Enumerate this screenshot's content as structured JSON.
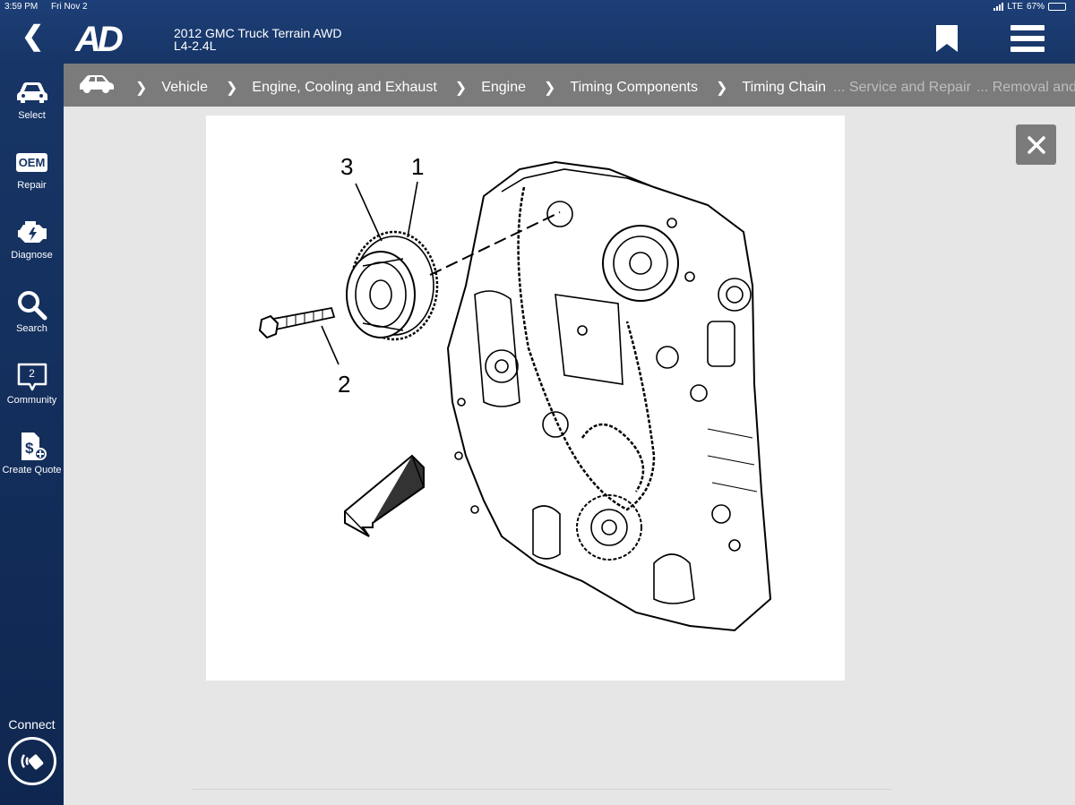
{
  "status_bar": {
    "time": "3:59 PM",
    "date": "Fri Nov 2",
    "network": "LTE",
    "battery": "67%"
  },
  "header": {
    "logo_text": "AD",
    "vehicle_name": "2012 GMC Truck Terrain AWD",
    "engine": "L4-2.4L",
    "icons": [
      "back-chevron-icon",
      "bookmark-icon",
      "hamburger-menu-icon"
    ]
  },
  "sidebar": {
    "items": [
      {
        "label": "Select",
        "icon": "car-icon"
      },
      {
        "label": "Repair",
        "icon": "oem-icon",
        "icon_text": "OEM"
      },
      {
        "label": "Diagnose",
        "icon": "engine-icon"
      },
      {
        "label": "Search",
        "icon": "search-icon"
      },
      {
        "label": "Community",
        "icon": "chat-icon",
        "badge": "2"
      },
      {
        "label": "Create Quote",
        "icon": "quote-icon"
      }
    ],
    "connect_label": "Connect"
  },
  "breadcrumb": {
    "items": [
      "Vehicle",
      "Engine, Cooling and Exhaust",
      "Engine",
      "Timing Components",
      "Timing Chain"
    ],
    "faded_items": [
      "... Service and Repair",
      "... Removal and R"
    ]
  },
  "figure": {
    "callouts": [
      "3",
      "1",
      "2"
    ],
    "description_icon": "engine-timing-diagram"
  },
  "colors": {
    "header_bg": "#1d3f78",
    "sidebar_bg": "#173566",
    "breadcrumb_bg": "#7b7b7b",
    "content_bg": "#e6e6e6"
  }
}
